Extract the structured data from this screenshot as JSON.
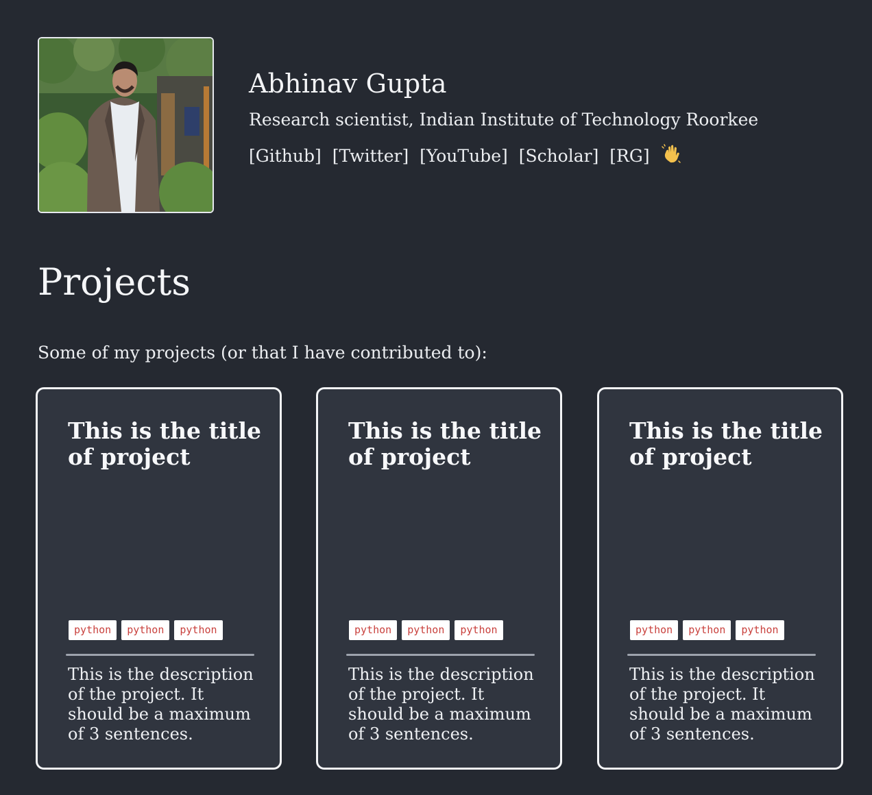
{
  "profile": {
    "name": "Abhinav Gupta",
    "role": "Research scientist, Indian Institute of Technology Roorkee",
    "links": [
      "[Github]",
      "[Twitter]",
      "[YouTube]",
      "[Scholar]",
      "[RG]"
    ],
    "wave_icon": "waving-hand-icon"
  },
  "projects": {
    "heading": "Projects",
    "intro": "Some of my projects (or that I have contributed to):",
    "cards": [
      {
        "title": "This is the title of project",
        "tags": [
          "python",
          "python",
          "python"
        ],
        "description": "This is the description of the project. It should be a maximum of 3 sentences."
      },
      {
        "title": "This is the title of project",
        "tags": [
          "python",
          "python",
          "python"
        ],
        "description": "This is the description of the project. It should be a maximum of 3 sentences."
      },
      {
        "title": "This is the title of project",
        "tags": [
          "python",
          "python",
          "python"
        ],
        "description": "This is the description of the project. It should be a maximum of 3 sentences."
      }
    ]
  },
  "colors": {
    "background": "#252931",
    "card_background": "#30353f",
    "card_border": "#f4f5f7",
    "tag_text": "#c9413d",
    "divider": "#9da3ad"
  }
}
